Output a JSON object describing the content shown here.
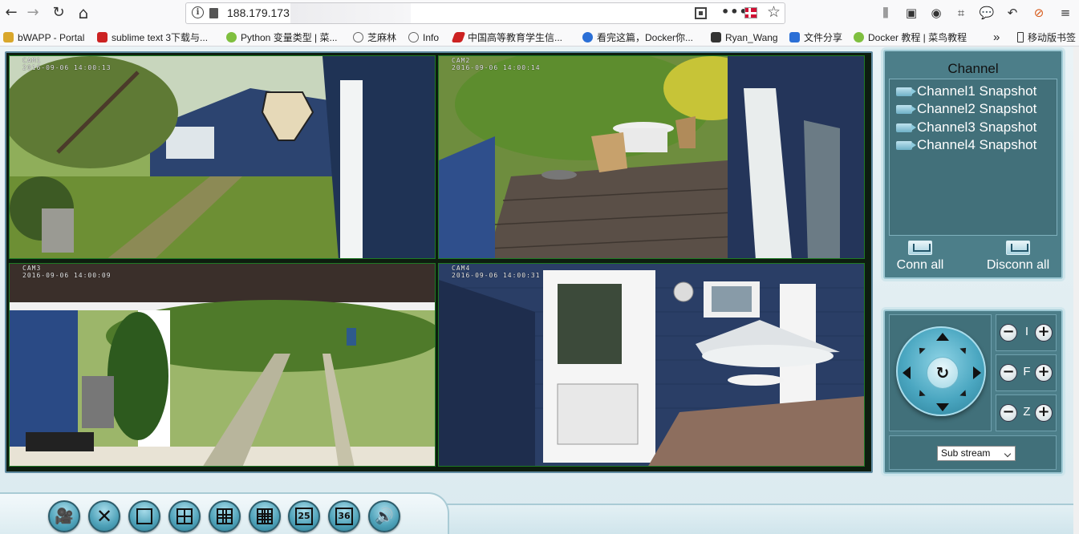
{
  "browser": {
    "url_visible": "188.179.173",
    "nav": {
      "back": "←",
      "forward": "→",
      "reload": "↻",
      "home": "⌂"
    },
    "bookmarks": [
      {
        "label": "bWAPP - Portal",
        "color": "#d9a72b"
      },
      {
        "label": "sublime text 3下载与...",
        "color": "#cc2222"
      },
      {
        "label": "Python 变量类型 | 菜...",
        "color": "#7fbf3f"
      },
      {
        "label": "芝麻林",
        "color": "#666666"
      },
      {
        "label": "Info",
        "color": "#666666"
      },
      {
        "label": "中国高等教育学生信...",
        "color": "#cc2222"
      },
      {
        "label": "看完这篇，Docker你...",
        "color": "#2b6fd6"
      },
      {
        "label": "Ryan_Wang",
        "color": "#333333"
      },
      {
        "label": "文件分享",
        "color": "#2b6fd6"
      },
      {
        "label": "Docker 教程 | 菜鸟教程",
        "color": "#7fbf3f"
      }
    ],
    "more_bookmarks": "»",
    "mobile_bookmarks": "移动版书签"
  },
  "viewer": {
    "cameras": [
      {
        "osd_name": "CAM1",
        "osd_time": "2016-09-06 14:00:13"
      },
      {
        "osd_name": "CAM2",
        "osd_time": "2016-09-06 14:00:14"
      },
      {
        "osd_name": "CAM3",
        "osd_time": "2016-09-06 14:00:09"
      },
      {
        "osd_name": "CAM4",
        "osd_time": "2016-09-06 14:00:31"
      }
    ],
    "channel_panel": {
      "title": "Channel",
      "items": [
        {
          "label": "Channel1 Snapshot"
        },
        {
          "label": "Channel2 Snapshot"
        },
        {
          "label": "Channel3 Snapshot"
        },
        {
          "label": "Channel4 Snapshot"
        }
      ],
      "conn_all": "Conn all",
      "disconn_all": "Disconn all"
    },
    "ptz": {
      "center_icon": "↻",
      "iris_label": "I",
      "focus_label": "F",
      "zoom_label": "Z",
      "minus": "−",
      "plus": "+"
    },
    "stream": {
      "selected": "Sub stream"
    },
    "toolbar": {
      "buttons": [
        {
          "name": "record",
          "glyph": "🎥"
        },
        {
          "name": "settings",
          "glyph": "✕"
        },
        {
          "name": "layout-1"
        },
        {
          "name": "layout-4"
        },
        {
          "name": "layout-9"
        },
        {
          "name": "layout-16"
        },
        {
          "name": "layout-25",
          "number": "25"
        },
        {
          "name": "layout-36",
          "number": "36"
        },
        {
          "name": "audio",
          "glyph": "🔊"
        }
      ]
    }
  }
}
